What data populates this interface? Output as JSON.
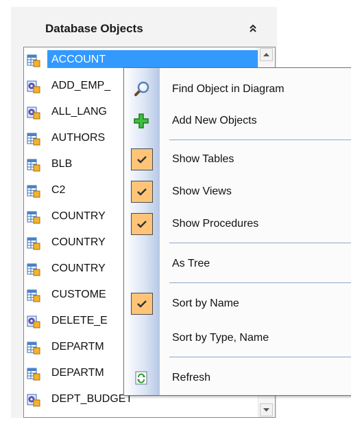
{
  "panel": {
    "title": "Database Objects",
    "collapse_icon": "double-chevron-up-icon"
  },
  "objects": {
    "items": [
      {
        "label": "ACCOUNT",
        "icon": "table-icon",
        "selected": true
      },
      {
        "label": "ADD_EMP_",
        "icon": "procedure-icon"
      },
      {
        "label": "ALL_LANG",
        "icon": "procedure-icon"
      },
      {
        "label": "AUTHORS",
        "icon": "table-icon"
      },
      {
        "label": "BLB",
        "icon": "table-icon"
      },
      {
        "label": "C2",
        "icon": "table-icon"
      },
      {
        "label": "COUNTRY",
        "icon": "table-icon"
      },
      {
        "label": "COUNTRY",
        "icon": "table-icon"
      },
      {
        "label": "COUNTRY",
        "icon": "table-icon"
      },
      {
        "label": "CUSTOME",
        "icon": "table-icon"
      },
      {
        "label": "DELETE_E",
        "icon": "procedure-icon"
      },
      {
        "label": "DEPARTM",
        "icon": "table-icon"
      },
      {
        "label": "DEPARTM",
        "icon": "table-icon"
      },
      {
        "label": "DEPT_BUDGET",
        "icon": "procedure-icon"
      }
    ]
  },
  "context_menu": {
    "find_object": {
      "label": "Find Object in Diagram",
      "icon": "magnifier-icon"
    },
    "add_new": {
      "label": "Add New Objects",
      "icon": "green-plus-icon"
    },
    "show_tables": {
      "label": "Show Tables",
      "checked": true
    },
    "show_views": {
      "label": "Show Views",
      "checked": true
    },
    "show_procedures": {
      "label": "Show Procedures",
      "checked": true
    },
    "as_tree": {
      "label": "As Tree",
      "checked": false
    },
    "sort_by_name": {
      "label": "Sort by Name",
      "checked": true
    },
    "sort_by_type_name": {
      "label": "Sort by Type, Name",
      "checked": false
    },
    "refresh": {
      "label": "Refresh",
      "icon": "refresh-icon"
    }
  },
  "colors": {
    "selection": "#3399ff",
    "checked_background": "#ffc478",
    "menu_rail": "#b7c8e6"
  }
}
